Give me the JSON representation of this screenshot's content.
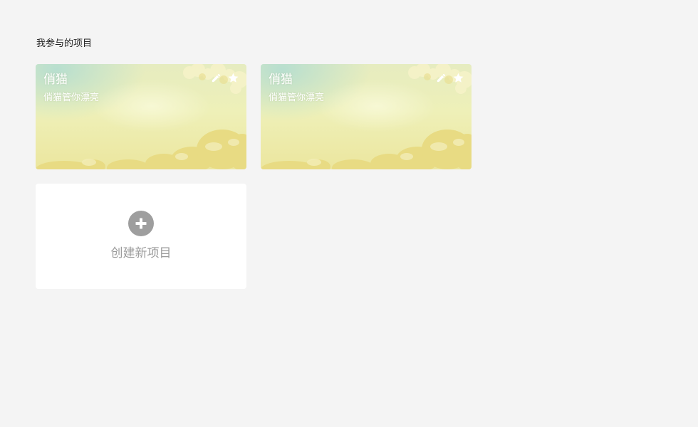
{
  "section": {
    "title": "我参与的项目"
  },
  "projects": [
    {
      "title": "俏猫",
      "subtitle": "俏猫管你漂亮"
    },
    {
      "title": "俏猫",
      "subtitle": "俏猫管你漂亮"
    }
  ],
  "icons": {
    "edit": "pencil-icon",
    "favorite": "star-icon",
    "create": "plus-circle-icon"
  },
  "create_card": {
    "label": "创建新项目"
  },
  "colors": {
    "page_background": "#f4f4f4",
    "card_text": "#ffffff",
    "create_icon": "#9e9e9e",
    "create_text": "#9a9a9a"
  }
}
